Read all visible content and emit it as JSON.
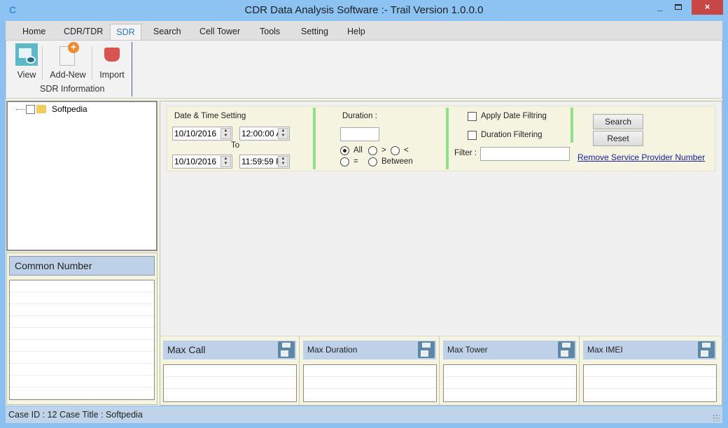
{
  "window": {
    "title": "CDR Data Analysis Software :- Trail Version 1.0.0.0",
    "app_icon": "C",
    "minimize": "_",
    "close": "×"
  },
  "menu": {
    "tabs": [
      {
        "label": "Home"
      },
      {
        "label": "CDR/TDR"
      },
      {
        "label": "SDR",
        "active": true
      },
      {
        "label": "Search"
      },
      {
        "label": "Cell Tower"
      },
      {
        "label": "Tools"
      },
      {
        "label": "Setting"
      },
      {
        "label": "Help"
      }
    ]
  },
  "ribbon": {
    "buttons": [
      {
        "label": "View",
        "icon": "view-icon"
      },
      {
        "label": "Add-New",
        "icon": "add-new-icon"
      },
      {
        "label": "Import",
        "icon": "import-icon"
      }
    ],
    "group_label": "SDR Information"
  },
  "tree": {
    "nodes": [
      {
        "label": "Softpedia",
        "checked": false
      }
    ]
  },
  "common_number": {
    "title": "Common Number",
    "rows": []
  },
  "filters": {
    "date_time_title": "Date & Time Setting",
    "from_date": "10/10/2016",
    "from_time": "12:00:00 A",
    "to_label": "To",
    "to_date": "10/10/2016",
    "to_time": "11:59:59 F",
    "duration_label": "Duration :",
    "duration_value": "",
    "radio_options": [
      {
        "label": "All",
        "checked": true
      },
      {
        "label": ">",
        "checked": false
      },
      {
        "label": "<",
        "checked": false
      },
      {
        "label": "=",
        "checked": false
      },
      {
        "label": "Between",
        "checked": false
      }
    ],
    "apply_date_filtering": {
      "label": "Apply Date Filtring",
      "checked": false
    },
    "duration_filtering": {
      "label": "Duration Filtering",
      "checked": false
    },
    "filter_label": "Filter :",
    "filter_value": "",
    "search_button": "Search",
    "reset_button": "Reset",
    "remove_link": "Remove Service Provider Number"
  },
  "stats": [
    {
      "title": "Max Call",
      "rows": []
    },
    {
      "title": "Max Duration",
      "rows": []
    },
    {
      "title": "Max Tower",
      "rows": []
    },
    {
      "title": "Max IMEI",
      "rows": []
    }
  ],
  "status": {
    "text": "Case ID : 12  Case Title : Softpedia"
  }
}
